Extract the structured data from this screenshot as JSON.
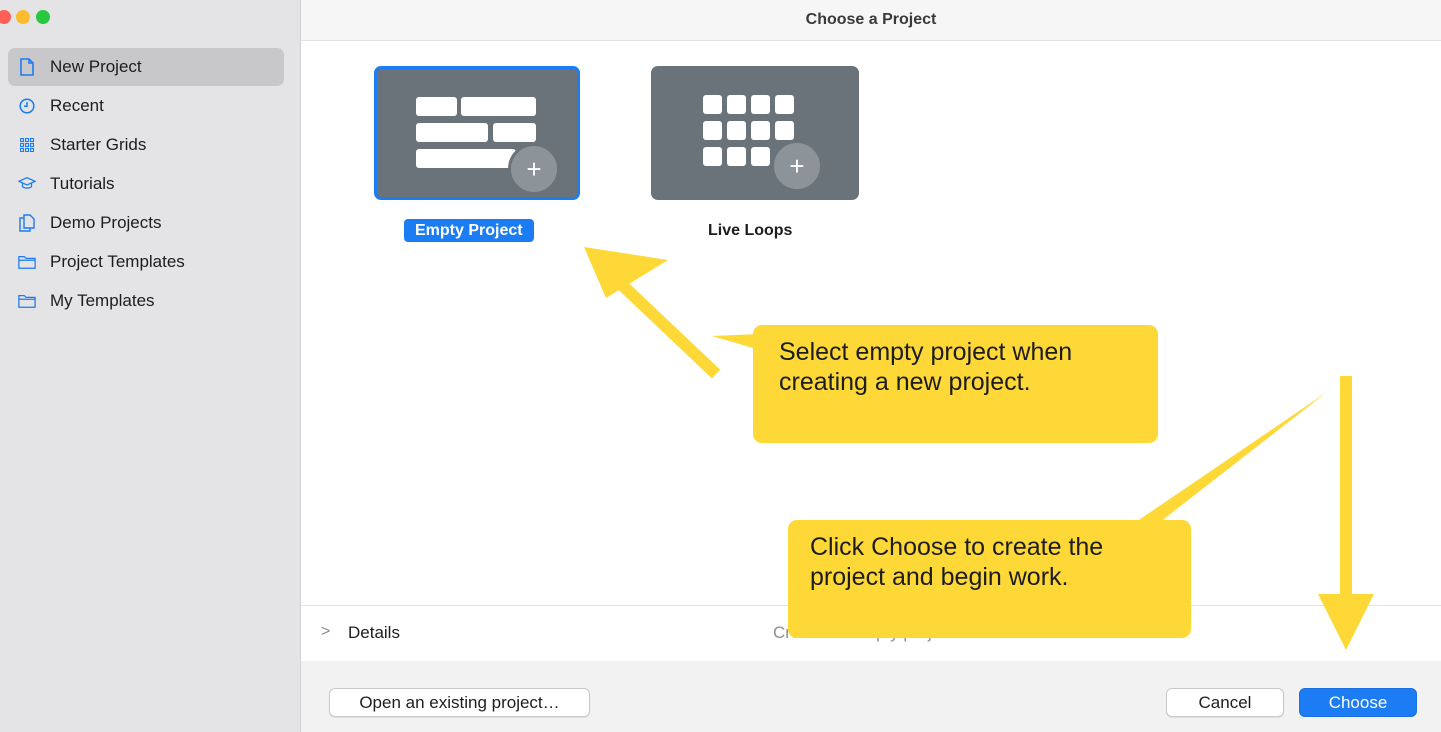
{
  "window": {
    "title": "Choose a Project"
  },
  "sidebar": {
    "items": [
      {
        "label": "New Project",
        "icon": "new-document-icon",
        "selected": true
      },
      {
        "label": "Recent",
        "icon": "clock-icon"
      },
      {
        "label": "Starter Grids",
        "icon": "grid-icon"
      },
      {
        "label": "Tutorials",
        "icon": "graduation-cap-icon"
      },
      {
        "label": "Demo Projects",
        "icon": "document-copy-icon"
      },
      {
        "label": "Project Templates",
        "icon": "folder-icon"
      },
      {
        "label": "My Templates",
        "icon": "folder-icon"
      }
    ]
  },
  "templates": [
    {
      "label": "Empty Project",
      "selected": true
    },
    {
      "label": "Live Loops",
      "selected": false
    }
  ],
  "details": {
    "label": "Details",
    "description": "Create an empty project"
  },
  "buttons": {
    "open": "Open an existing project…",
    "cancel": "Cancel",
    "choose": "Choose"
  },
  "annotations": {
    "callout_1": {
      "line1": "Select empty project when",
      "line2": "creating a new project."
    },
    "callout_2": {
      "line1": "Click Choose to create the",
      "line2": "project and begin work."
    }
  },
  "colors": {
    "accent": "#1b7cf4",
    "callout": "#fed836",
    "arrow": "#fed836",
    "tile": "#6a737a"
  }
}
